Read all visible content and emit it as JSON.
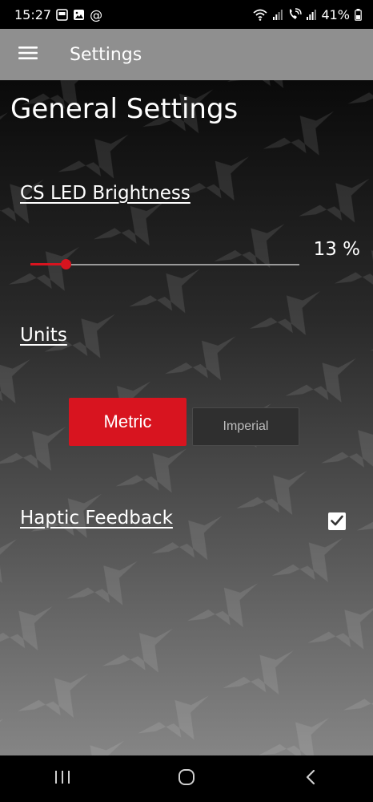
{
  "status_bar": {
    "time": "15:27",
    "at_symbol": "@",
    "battery": "41%"
  },
  "app_bar": {
    "title": "Settings"
  },
  "page": {
    "title": "General Settings"
  },
  "brightness": {
    "label": "CS LED Brightness",
    "value_text": "13 %",
    "value_fraction": 0.13
  },
  "units": {
    "label": "Units",
    "options": [
      "Metric",
      "Imperial"
    ],
    "selected": "Metric"
  },
  "haptic": {
    "label": "Haptic Feedback",
    "checked": true
  },
  "colors": {
    "accent": "#d8141f",
    "app_bar": "#8f8f8f",
    "inactive_button": "#2f2f2f"
  },
  "icons": {
    "menu": "hamburger-menu-icon",
    "nav_recents": "recent-apps-icon",
    "nav_home": "home-icon",
    "nav_back": "back-icon"
  }
}
